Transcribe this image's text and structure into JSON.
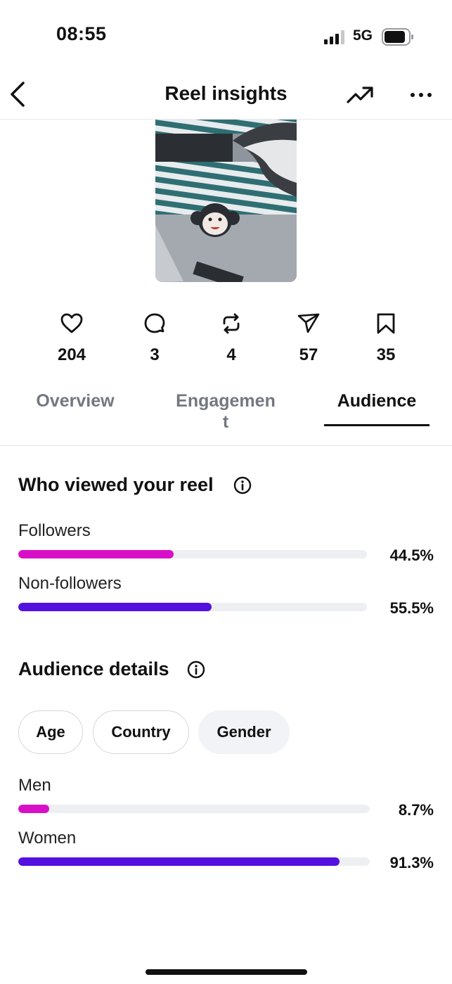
{
  "status_bar": {
    "time": "08:55",
    "network": "5G"
  },
  "header": {
    "title": "Reel insights"
  },
  "stats": [
    {
      "icon": "heart-icon",
      "value": "204"
    },
    {
      "icon": "comment-icon",
      "value": "3"
    },
    {
      "icon": "repost-icon",
      "value": "4"
    },
    {
      "icon": "share-icon",
      "value": "57"
    },
    {
      "icon": "bookmark-icon",
      "value": "35"
    }
  ],
  "tabs": [
    {
      "label": "Overview",
      "active": false
    },
    {
      "label": "Engagemen\nt",
      "active": false
    },
    {
      "label": "Audience",
      "active": true
    }
  ],
  "viewers": {
    "title": "Who viewed your reel",
    "rows": [
      {
        "label": "Followers",
        "percent_text": "44.5%",
        "percent": 44.5,
        "color": "#d90fc8"
      },
      {
        "label": "Non-followers",
        "percent_text": "55.5%",
        "percent": 55.5,
        "color": "#5410de"
      }
    ]
  },
  "audience": {
    "title": "Audience details",
    "filters": [
      {
        "label": "Age",
        "selected": false
      },
      {
        "label": "Country",
        "selected": false
      },
      {
        "label": "Gender",
        "selected": true
      }
    ],
    "rows": [
      {
        "label": "Men",
        "percent_text": "8.7%",
        "percent": 8.7,
        "color": "#d90fc8"
      },
      {
        "label": "Women",
        "percent_text": "91.3%",
        "percent": 91.3,
        "color": "#5410de"
      }
    ]
  }
}
